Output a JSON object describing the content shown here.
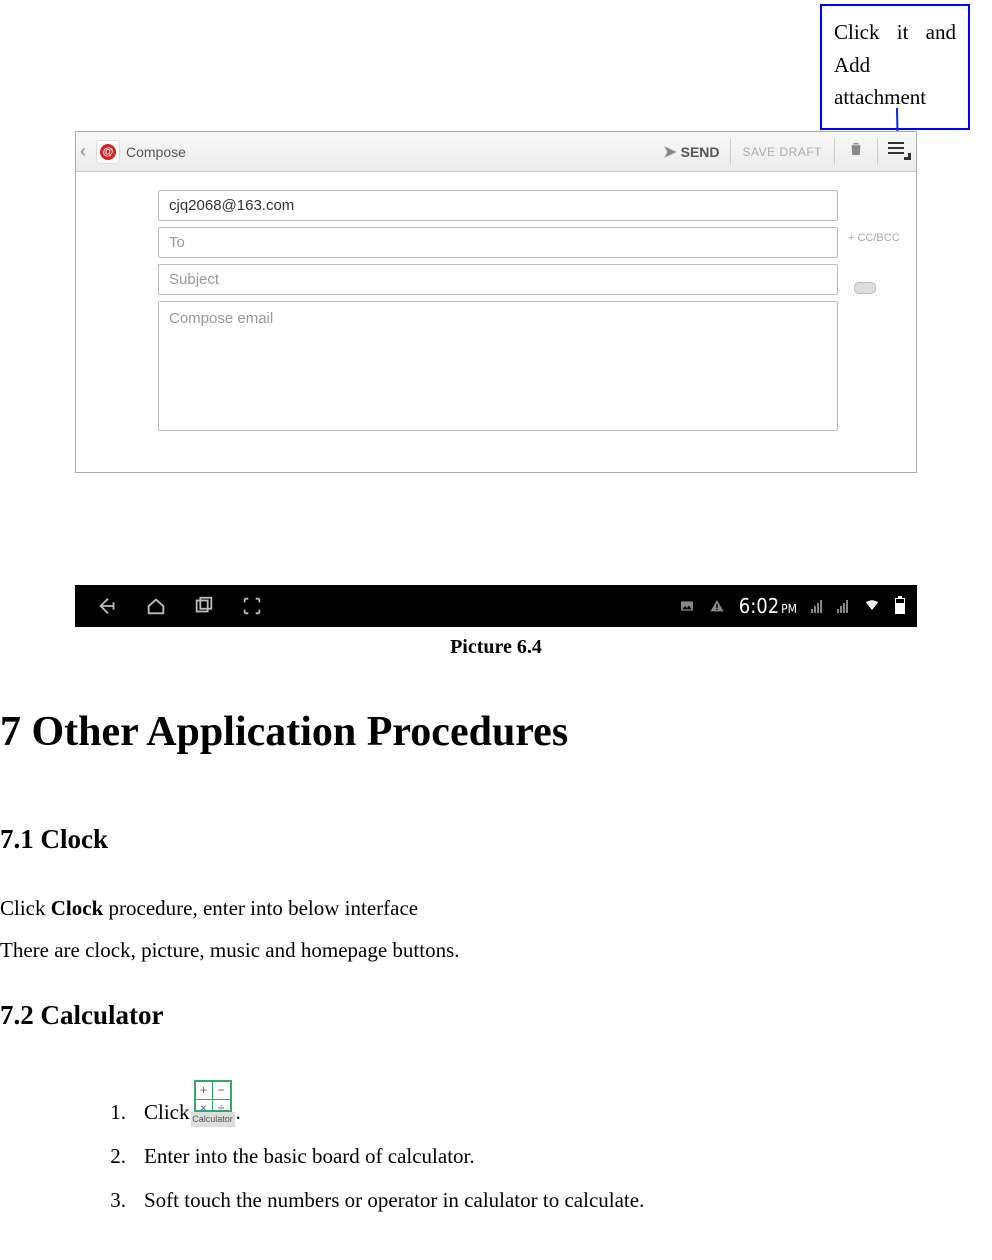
{
  "callout": {
    "text": "Click it and Add attachment"
  },
  "compose": {
    "compose_label": "Compose",
    "send_label": "SEND",
    "save_draft_label": "SAVE DRAFT",
    "from_value": "cjq2068@163.com",
    "to_placeholder": "To",
    "subject_placeholder": "Subject",
    "body_placeholder": "Compose email",
    "ccbcc_label": "CC/BCC"
  },
  "navbar": {
    "time": "6:02",
    "ampm": "PM"
  },
  "caption": "Picture 6.4",
  "headings": {
    "chapter": "7 Other Application Procedures",
    "clock": "7.1 Clock",
    "calculator": "7.2 Calculator"
  },
  "paragraphs": {
    "clock_p1_pre": "Click ",
    "clock_p1_bold": "Clock",
    "clock_p1_post": " procedure, enter into below interface",
    "clock_p2": "There are clock, picture, music and homepage buttons."
  },
  "list": {
    "item1_pre": "Click",
    "item1_post": ".",
    "item2": "Enter into the basic board of calculator.",
    "item3": "Soft touch the numbers or operator in calulator to calculate.",
    "calc_icon_label": "Calculator"
  }
}
